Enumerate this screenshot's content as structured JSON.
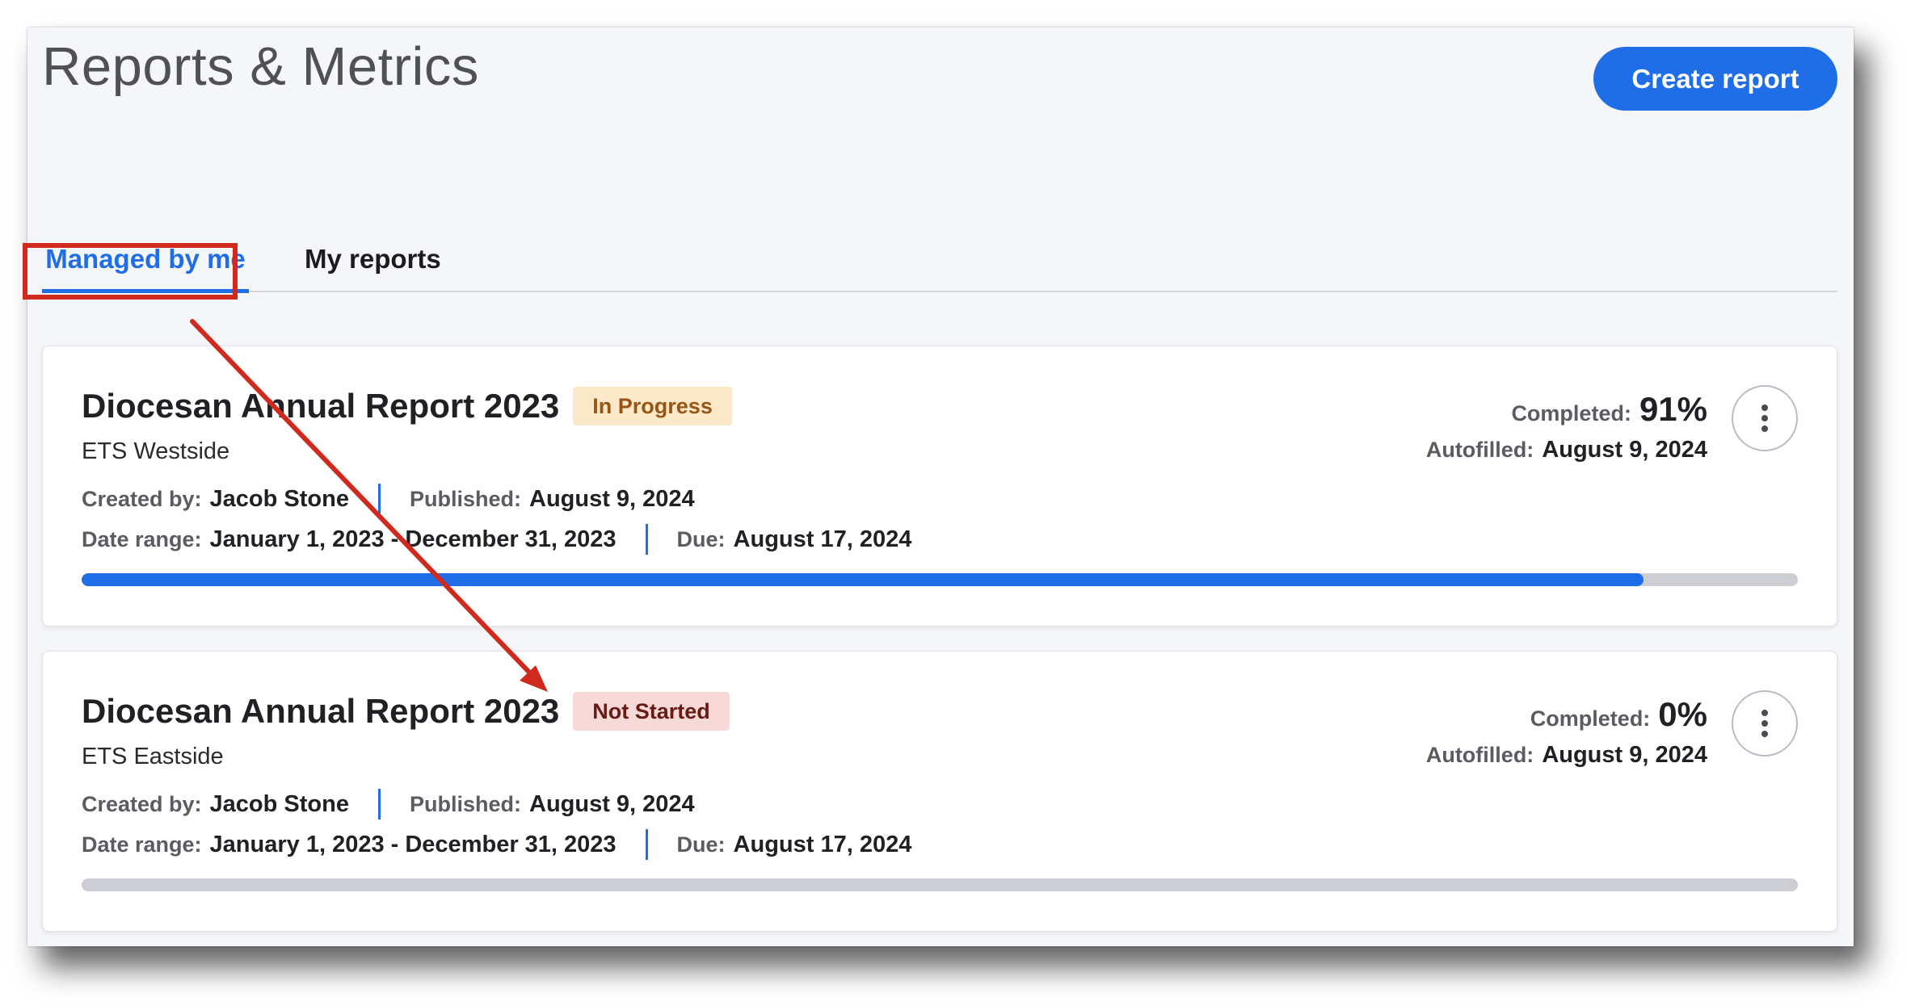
{
  "header": {
    "title": "Reports & Metrics",
    "create_button": "Create report"
  },
  "tabs": [
    {
      "label": "Managed by me",
      "active": true
    },
    {
      "label": "My reports",
      "active": false
    }
  ],
  "labels": {
    "created_by": "Created by:",
    "published": "Published:",
    "date_range": "Date range:",
    "due": "Due:",
    "completed": "Completed:",
    "autofilled": "Autofilled:"
  },
  "reports": [
    {
      "title": "Diocesan Annual Report 2023",
      "status": "In Progress",
      "organization": "ETS Westside",
      "created_by": "Jacob Stone",
      "published": "August 9, 2024",
      "date_range": "January 1, 2023 - December 31, 2023",
      "due": "August 17, 2024",
      "completed": "91%",
      "progress_fraction": 0.91,
      "autofilled": "August 9, 2024"
    },
    {
      "title": "Diocesan Annual Report 2023",
      "status": "Not Started",
      "organization": "ETS Eastside",
      "created_by": "Jacob Stone",
      "published": "August 9, 2024",
      "date_range": "January 1, 2023 - December 31, 2023",
      "due": "August 17, 2024",
      "completed": "0%",
      "progress_fraction": 0,
      "autofilled": "August 9, 2024"
    }
  ],
  "colors": {
    "accent": "#1f6ee8",
    "annotation": "#d0291d",
    "badge_in_progress_bg": "#fbe9c9",
    "badge_not_started_bg": "#f7d9d8"
  },
  "icons": {
    "menu": "more-vertical-icon"
  }
}
